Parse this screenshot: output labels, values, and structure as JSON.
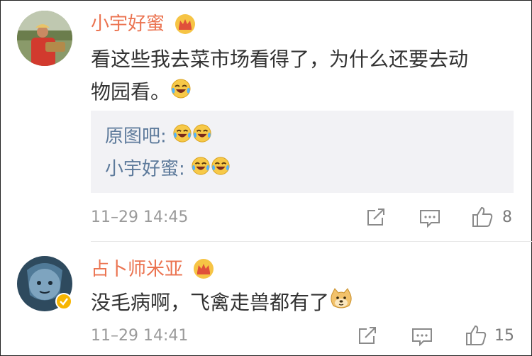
{
  "comments": [
    {
      "username": "小宇好蜜",
      "text_line1": "看这些我去菜市场看得了，为什么还要去动",
      "text_line2": "物园看。",
      "quote_lines": [
        {
          "label": "原图吧:"
        },
        {
          "label": "小宇好蜜:"
        }
      ],
      "time": "11–29 14:45",
      "likes": "8"
    },
    {
      "username": "占卜师米亚",
      "text": "没毛病啊，飞禽走兽都有了",
      "time": "11–29 14:41",
      "likes": "15"
    }
  ],
  "colors": {
    "username": "#eb7350",
    "quote_text": "#5d7a9b",
    "body_text": "#333333",
    "meta_text": "#9a9a9a",
    "quote_bg": "#f2f2f5"
  },
  "icons": [
    "crown-icon",
    "laugh-cry-emoji",
    "doge-emoji",
    "share-icon",
    "comment-icon",
    "like-icon",
    "verified-icon"
  ]
}
